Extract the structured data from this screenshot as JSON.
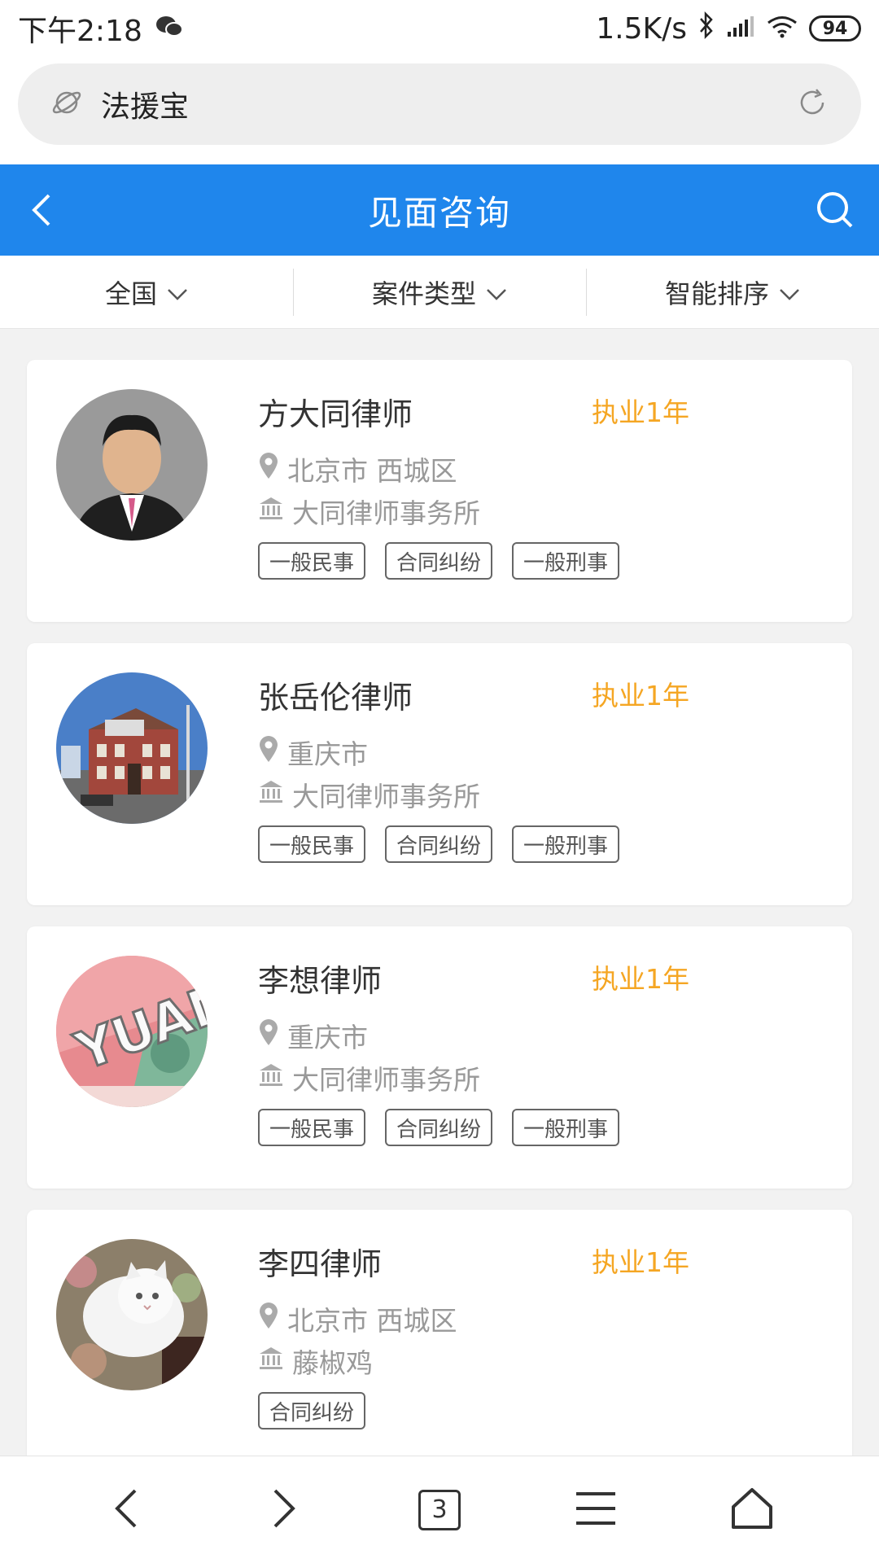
{
  "status_bar": {
    "time": "下午2:18",
    "speed": "1.5K/s",
    "battery": "94"
  },
  "browser": {
    "address": "法援宝",
    "tab_count": "3"
  },
  "header": {
    "title": "见面咨询"
  },
  "filters": [
    "全国",
    "案件类型",
    "智能排序"
  ],
  "lawyers": [
    {
      "name": "方大同律师",
      "years": "执业1年",
      "location": "北京市 西城区",
      "firm": "大同律师事务所",
      "tags": [
        "一般民事",
        "合同纠纷",
        "一般刑事"
      ]
    },
    {
      "name": "张岳伦律师",
      "years": "执业1年",
      "location": "重庆市",
      "firm": "大同律师事务所",
      "tags": [
        "一般民事",
        "合同纠纷",
        "一般刑事"
      ]
    },
    {
      "name": "李想律师",
      "years": "执业1年",
      "location": "重庆市",
      "firm": "大同律师事务所",
      "tags": [
        "一般民事",
        "合同纠纷",
        "一般刑事"
      ]
    },
    {
      "name": "李四律师",
      "years": "执业1年",
      "location": "北京市 西城区",
      "firm": "藤椒鸡",
      "tags": [
        "合同纠纷"
      ]
    }
  ],
  "colors": {
    "accent": "#1f86ec",
    "experience": "#f5a623"
  }
}
